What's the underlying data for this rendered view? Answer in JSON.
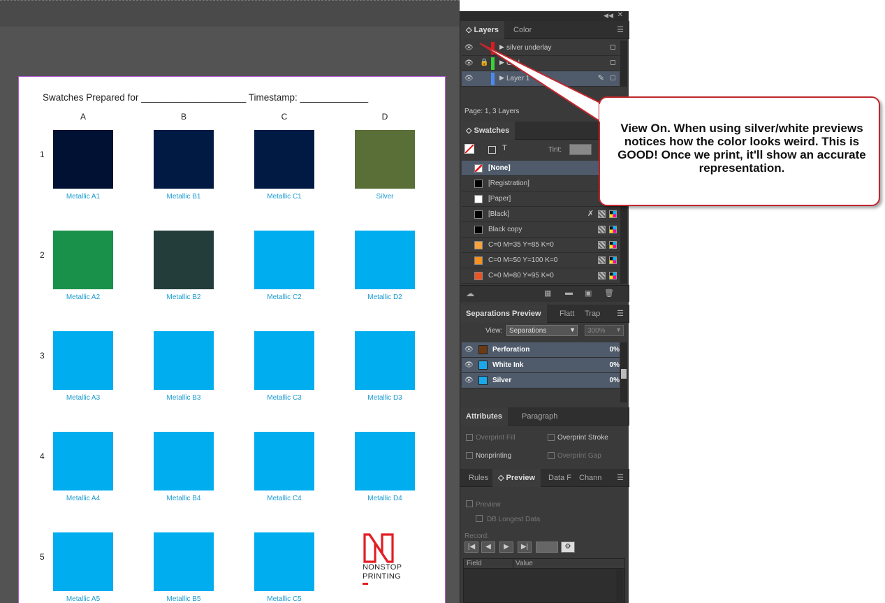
{
  "document": {
    "header_text": "Swatches Prepared for ____________________   Timestamp: _____________",
    "columns": [
      "A",
      "B",
      "C",
      "D"
    ],
    "rows": [
      "1",
      "2",
      "3",
      "4",
      "5"
    ],
    "swatches": [
      [
        "Metallic A1",
        "Metallic B1",
        "Metallic C1",
        "Silver"
      ],
      [
        "Metallic A2",
        "Metallic B2",
        "Metallic C2",
        "Metallic D2"
      ],
      [
        "Metallic A3",
        "Metallic B3",
        "Metallic C3",
        "Metallic D3"
      ],
      [
        "Metallic A4",
        "Metallic B4",
        "Metallic C4",
        "Metallic D4"
      ],
      [
        "Metallic A5",
        "Metallic B5",
        "Metallic C5",
        ""
      ]
    ],
    "swatch_colors": [
      [
        "#001133",
        "#001a44",
        "#001a44",
        "#5a6e38"
      ],
      [
        "#1a914a",
        "#223d3a",
        "#00adef",
        "#00adef"
      ],
      [
        "#00adef",
        "#00adef",
        "#00adef",
        "#00adef"
      ],
      [
        "#00adef",
        "#00adef",
        "#00adef",
        "#00adef"
      ],
      [
        "#00adef",
        "#00adef",
        "#00adef",
        ""
      ]
    ],
    "logo_line1": "NONSTOP",
    "logo_line2": "PRINTING"
  },
  "layers_panel": {
    "tabs": [
      "Layers",
      "Color"
    ],
    "layers": [
      {
        "name": "silver underlay",
        "color": "#e0191f",
        "locked": false
      },
      {
        "name": "Grid",
        "color": "#3ad13a",
        "locked": true
      },
      {
        "name": "Layer 1",
        "color": "#4a8af0",
        "locked": false
      }
    ],
    "status": "Page: 1, 3 Layers"
  },
  "swatches_panel": {
    "tab": "Swatches",
    "tint_label": "Tint:",
    "items": [
      {
        "name": "[None]",
        "color": "none"
      },
      {
        "name": "[Registration]",
        "color": "#000000"
      },
      {
        "name": "[Paper]",
        "color": "#ffffff"
      },
      {
        "name": "[Black]",
        "color": "#000000"
      },
      {
        "name": "Black copy",
        "color": "#000000"
      },
      {
        "name": "C=0 M=35 Y=85 K=0",
        "color": "#f7a23c"
      },
      {
        "name": "C=0 M=50 Y=100 K=0",
        "color": "#f5911e"
      },
      {
        "name": "C=0 M=80 Y=95 K=0",
        "color": "#ea5424"
      }
    ]
  },
  "separations_panel": {
    "tabs": [
      "Separations Preview",
      "Flatt",
      "Trap"
    ],
    "view_label": "View:",
    "view_value": "Separations",
    "zoom_value": "300%",
    "items": [
      {
        "name": "Perforation",
        "color": "#6b3a12",
        "pct": "0%"
      },
      {
        "name": "White Ink",
        "color": "#1ba8e8",
        "pct": "0%"
      },
      {
        "name": "Silver",
        "color": "#1ba8e8",
        "pct": "0%"
      }
    ]
  },
  "attributes_panel": {
    "tabs": [
      "Attributes",
      "Paragraph"
    ],
    "overprint_fill": "Overprint Fill",
    "overprint_stroke": "Overprint Stroke",
    "nonprinting": "Nonprinting",
    "overprint_gap": "Overprint Gap"
  },
  "preview_panel": {
    "tabs": [
      "Rules",
      "Preview",
      "Data F",
      "Chann"
    ],
    "preview_label": "Preview",
    "db_longest": "DB Longest Data",
    "record_label": "Record:",
    "field_header": "Field",
    "value_header": "Value"
  },
  "callout": {
    "text": "View On. When using silver/white previews notices how the color looks weird. This is GOOD! Once we print, it'll show an accurate representation."
  }
}
